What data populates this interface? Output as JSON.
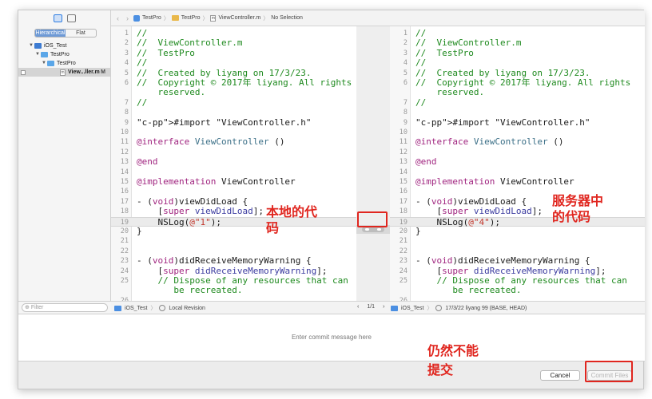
{
  "sidebar": {
    "segments": [
      "Hierarchical",
      "Flat"
    ],
    "tree": [
      {
        "label": "iOS_Test",
        "level": 0,
        "kind": "project"
      },
      {
        "label": "TestPro",
        "level": 1,
        "kind": "folder"
      },
      {
        "label": "TestPro",
        "level": 2,
        "kind": "folder"
      },
      {
        "label": "View...ller.m",
        "level": 3,
        "kind": "file",
        "badge": "M"
      }
    ],
    "filter_placeholder": "Filter"
  },
  "jumpbar": {
    "crumbs": [
      "TestPro",
      "TestPro",
      "ViewController.m",
      "No Selection"
    ]
  },
  "left_pane": {
    "lines": [
      {
        "n": "1",
        "t": "//",
        "c": "com"
      },
      {
        "n": "2",
        "t": "//  ViewController.m",
        "c": "com"
      },
      {
        "n": "3",
        "t": "//  TestPro",
        "c": "com"
      },
      {
        "n": "4",
        "t": "//",
        "c": "com"
      },
      {
        "n": "5",
        "t": "//  Created by liyang on 17/3/23.",
        "c": "com"
      },
      {
        "n": "6",
        "t": "//  Copyright © 2017年 liyang. All rights",
        "c": "com"
      },
      {
        "n": "",
        "t": "    reserved.",
        "c": "com"
      },
      {
        "n": "7",
        "t": "//",
        "c": "com"
      },
      {
        "n": "8",
        "t": "",
        "c": ""
      },
      {
        "n": "9",
        "t": "#import \"ViewController.h\"",
        "c": "import"
      },
      {
        "n": "10",
        "t": "",
        "c": ""
      },
      {
        "n": "11",
        "t": "@interface ViewController ()",
        "c": "iface"
      },
      {
        "n": "12",
        "t": "",
        "c": ""
      },
      {
        "n": "13",
        "t": "@end",
        "c": "kw"
      },
      {
        "n": "14",
        "t": "",
        "c": ""
      },
      {
        "n": "15",
        "t": "@implementation ViewController",
        "c": "impl"
      },
      {
        "n": "16",
        "t": "",
        "c": ""
      },
      {
        "n": "17",
        "t": "- (void)viewDidLoad {",
        "c": "method"
      },
      {
        "n": "18",
        "t": "    [super viewDidLoad];",
        "c": "super"
      },
      {
        "n": "19",
        "t": "    NSLog(@\"1\");",
        "c": "nslog",
        "hl": true
      },
      {
        "n": "20",
        "t": "}",
        "c": ""
      },
      {
        "n": "21",
        "t": "",
        "c": ""
      },
      {
        "n": "22",
        "t": "",
        "c": ""
      },
      {
        "n": "23",
        "t": "- (void)didReceiveMemoryWarning {",
        "c": "method"
      },
      {
        "n": "24",
        "t": "    [super didReceiveMemoryWarning];",
        "c": "super"
      },
      {
        "n": "25",
        "t": "    // Dispose of any resources that can",
        "c": "com"
      },
      {
        "n": "",
        "t": "       be recreated.",
        "c": "com"
      },
      {
        "n": "26",
        "t": "",
        "c": ""
      }
    ]
  },
  "right_pane": {
    "lines": [
      {
        "n": "1",
        "t": "//",
        "c": "com"
      },
      {
        "n": "2",
        "t": "//  ViewController.m",
        "c": "com"
      },
      {
        "n": "3",
        "t": "//  TestPro",
        "c": "com"
      },
      {
        "n": "4",
        "t": "//",
        "c": "com"
      },
      {
        "n": "5",
        "t": "//  Created by liyang on 17/3/23.",
        "c": "com"
      },
      {
        "n": "6",
        "t": "//  Copyright © 2017年 liyang. All rights",
        "c": "com"
      },
      {
        "n": "",
        "t": "    reserved.",
        "c": "com"
      },
      {
        "n": "7",
        "t": "//",
        "c": "com"
      },
      {
        "n": "8",
        "t": "",
        "c": ""
      },
      {
        "n": "9",
        "t": "#import \"ViewController.h\"",
        "c": "import"
      },
      {
        "n": "10",
        "t": "",
        "c": ""
      },
      {
        "n": "11",
        "t": "@interface ViewController ()",
        "c": "iface"
      },
      {
        "n": "12",
        "t": "",
        "c": ""
      },
      {
        "n": "13",
        "t": "@end",
        "c": "kw"
      },
      {
        "n": "14",
        "t": "",
        "c": ""
      },
      {
        "n": "15",
        "t": "@implementation ViewController",
        "c": "impl"
      },
      {
        "n": "16",
        "t": "",
        "c": ""
      },
      {
        "n": "17",
        "t": "- (void)viewDidLoad {",
        "c": "method"
      },
      {
        "n": "18",
        "t": "    [super viewDidLoad];",
        "c": "super"
      },
      {
        "n": "19",
        "t": "    NSLog(@\"4\");",
        "c": "nslog",
        "hl": true
      },
      {
        "n": "20",
        "t": "}",
        "c": ""
      },
      {
        "n": "21",
        "t": "",
        "c": ""
      },
      {
        "n": "22",
        "t": "",
        "c": ""
      },
      {
        "n": "23",
        "t": "- (void)didReceiveMemoryWarning {",
        "c": "method"
      },
      {
        "n": "24",
        "t": "    [super didReceiveMemoryWarning];",
        "c": "super"
      },
      {
        "n": "25",
        "t": "    // Dispose of any resources that can",
        "c": "com"
      },
      {
        "n": "",
        "t": "       be recreated.",
        "c": "com"
      },
      {
        "n": "26",
        "t": "",
        "c": ""
      }
    ]
  },
  "statusbar": {
    "left_project": "iOS_Test",
    "left_revision": "Local Revision",
    "pager": "1/1",
    "right_project": "iOS_Test",
    "right_revision": "17/3/22  liyang  99 (BASE, HEAD)"
  },
  "commit": {
    "placeholder": "Enter commit message here",
    "cancel_label": "Cancel",
    "commit_label": "Commit Files"
  },
  "annotations": {
    "local_code": "本地的代\n码",
    "server_code": "服务器中\n的代码",
    "still_fail": "仍然不能\n提交",
    "color": "#e0261f"
  }
}
